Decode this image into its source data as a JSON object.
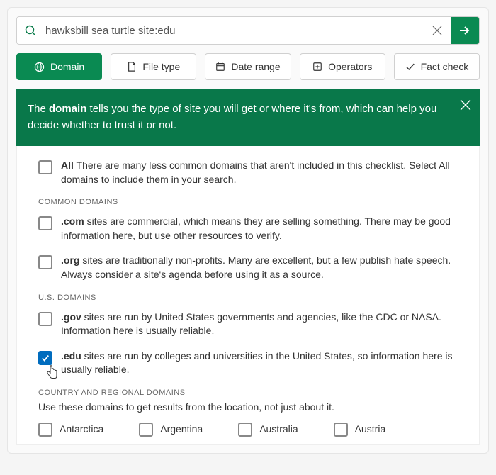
{
  "search": {
    "query": "hawksbill sea turtle site:edu"
  },
  "filters": {
    "domain": "Domain",
    "filetype": "File type",
    "daterange": "Date range",
    "operators": "Operators",
    "factcheck": "Fact check"
  },
  "banner": {
    "prefix": "The ",
    "bold": "domain",
    "rest": " tells you the type of site you will get or where it's from, which can help you decide whether to trust it or not."
  },
  "all_row": {
    "bold": "All",
    "rest": " There are many less common domains that aren't included in this checklist. Select All domains to include them in your search."
  },
  "sections": {
    "common_label": "COMMON DOMAINS",
    "com": {
      "bold": ".com",
      "rest": " sites are commercial, which means they are selling something. There may be good information here, but use other resources to verify."
    },
    "org": {
      "bold": ".org",
      "rest": " sites are traditionally non-profits. Many are excellent, but a few publish hate speech. Always consider a site's agenda before using it as a source."
    },
    "us_label": "U.S. DOMAINS",
    "gov": {
      "bold": ".gov",
      "rest": " sites are run by United States governments and agencies, like the CDC or NASA. Information here is usually reliable."
    },
    "edu": {
      "bold": ".edu",
      "rest": " sites are run by colleges and universities in the United States, so information here is usually reliable."
    },
    "country_label": "COUNTRY AND REGIONAL DOMAINS",
    "country_sub": "Use these domains to get results from the location, not just about it."
  },
  "countries": {
    "a": "Antarctica",
    "b": "Argentina",
    "c": "Australia",
    "d": "Austria"
  }
}
